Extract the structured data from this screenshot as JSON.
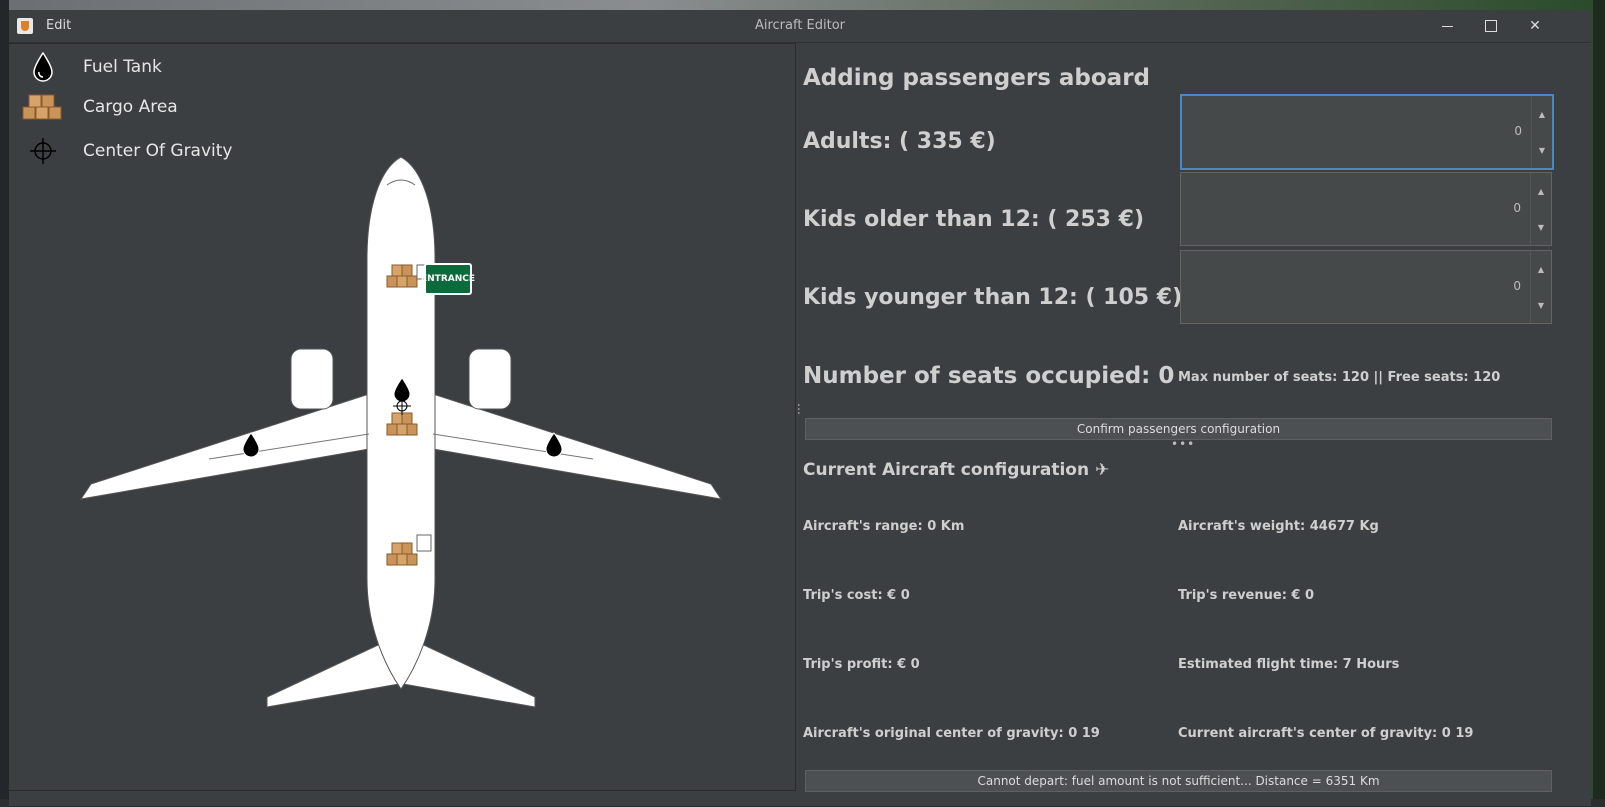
{
  "window": {
    "menu_edit": "Edit",
    "title": "Aircraft Editor"
  },
  "legend": {
    "fuel_tank": "Fuel Tank",
    "cargo_area": "Cargo Area",
    "center_of_gravity": "Center Of Gravity"
  },
  "aircraft": {
    "entrance_label": "ENTRANCE"
  },
  "passengers": {
    "heading": "Adding passengers aboard",
    "adults_label": "Adults: ( 335 €)",
    "adults_value": "0",
    "kids_older_label": "Kids older than 12: ( 253 €)",
    "kids_older_value": "0",
    "kids_younger_label": "Kids younger than 12: ( 105 €)",
    "kids_younger_value": "0",
    "seats_occupied": "Number of seats occupied: 0",
    "max_seats": "Max number of seats: 120 || Free seats: 120",
    "confirm_button": "Confirm passengers configuration"
  },
  "configuration": {
    "heading": "Current Aircraft configuration ✈",
    "range": "Aircraft's range: 0 Km",
    "weight": "Aircraft's weight: 44677 Kg",
    "cost": "Trip's cost: € 0",
    "revenue": "Trip's revenue: € 0",
    "profit": "Trip's profit: € 0",
    "flight_time": "Estimated flight time: 7 Hours",
    "original_cog": "Aircraft's original center of gravity: 0 19",
    "current_cog": "Current aircraft's center of gravity: 0 19"
  },
  "status": "Cannot depart: fuel amount is not sufficient... Distance = 6351 Km",
  "colors": {
    "background": "#3c3f41",
    "focus_border": "#4a88c7",
    "entrance_sign": "#0b6b3a"
  }
}
